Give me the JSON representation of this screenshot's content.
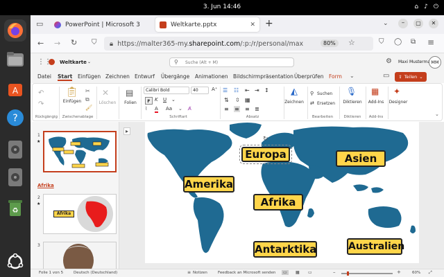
{
  "system": {
    "clock": "3. Jun  14:46"
  },
  "browser": {
    "tabs": [
      {
        "label": "PowerPoint | Microsoft 3"
      },
      {
        "label": "Weltkarte.pptx"
      }
    ],
    "url_prefix": "https://malter365-my.",
    "url_domain": "sharepoint.com",
    "url_suffix": "/:p:/r/personal/max",
    "zoom": "80%"
  },
  "app": {
    "file_name": "Weltkarte",
    "search_placeholder": "Suche (Alt + M)",
    "user_name": "Maxi Mustermann",
    "user_initials": "MM",
    "share_label": "Teilen"
  },
  "ribbon_tabs": [
    "Datei",
    "Start",
    "Einfügen",
    "Zeichnen",
    "Entwurf",
    "Übergänge",
    "Animationen",
    "Bildschirmpräsentation",
    "Überprüfen",
    "Form"
  ],
  "ribbon": {
    "undo": "Rückgängig",
    "paste": "Einfügen",
    "clipboard": "Zwischenablage",
    "delete": "Löschen",
    "slides_btn": "Folien",
    "font_name": "Calibri Bold",
    "font_size": "40",
    "font_group": "Schriftart",
    "paragraph_group": "Absatz",
    "draw_btn": "Zeichnen",
    "find": "Suchen",
    "replace": "Ersetzen",
    "edit_group": "Bearbeiten",
    "dictate": "Diktieren",
    "dictate_group": "Diktieren",
    "addins": "Add-Ins",
    "addins_group": "Add-Ins",
    "designer": "Designer"
  },
  "thumbnails": {
    "slide1_num": "1",
    "section_title": "Afrika",
    "slide2_num": "2",
    "slide2_label": "Afrika",
    "slide3_num": "3"
  },
  "slide_labels": {
    "europa": "Europa",
    "asien": "Asien",
    "amerika": "Amerika",
    "afrika": "Afrika",
    "antarktika": "Antarktika",
    "australien": "Australien"
  },
  "status": {
    "slide_info": "Folie 1 von 5",
    "language": "Deutsch (Deutschland)",
    "notes": "Notizen",
    "feedback": "Feedback an Microsoft senden",
    "zoom": "60%"
  },
  "colors": {
    "accent": "#c43e1c",
    "map": "#1f6a92",
    "label": "#ffd54a"
  }
}
